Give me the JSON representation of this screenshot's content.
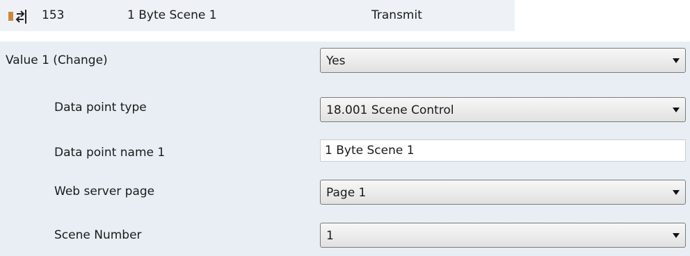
{
  "object": {
    "number": "153",
    "name": "1 Byte Scene 1",
    "flag": "Transmit",
    "icon": "communication-object-arrows-icon"
  },
  "parameters": {
    "value1_label": "Value 1 (Change)",
    "value1_value": "Yes",
    "dpt_label": "Data point type",
    "dpt_value": "18.001 Scene Control",
    "dp_name_label": "Data point name 1",
    "dp_name_value": "1 Byte Scene 1",
    "web_page_label": "Web server page",
    "web_page_value": "Page 1",
    "scene_label": "Scene Number",
    "scene_value": "1"
  },
  "colors": {
    "header_bg": "#eef2f6",
    "panel_bg": "#e8eef4",
    "icon_orange": "#c98a3e"
  }
}
